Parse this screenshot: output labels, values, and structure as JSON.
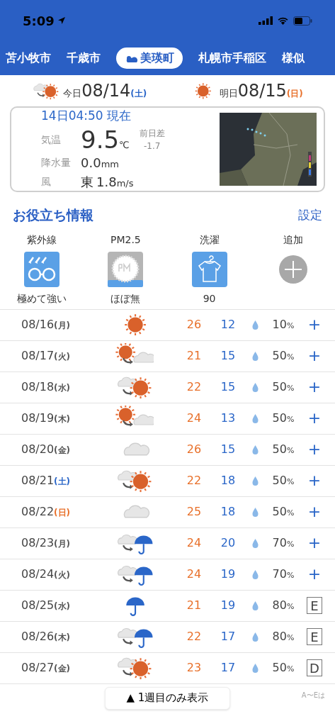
{
  "status_bar": {
    "time": "5:09"
  },
  "tabs": [
    {
      "label": "苫小牧市",
      "selected": false
    },
    {
      "label": "千歳市",
      "selected": false
    },
    {
      "label": "美瑛町",
      "selected": true
    },
    {
      "label": "札幌市手稲区",
      "selected": false
    },
    {
      "label": "様似",
      "selected": false
    }
  ],
  "summary": [
    {
      "weather": {
        "kind": "cloud_to_sun"
      },
      "prefix": "今日",
      "date": "08/14",
      "weekday": "(土)",
      "color": "#2a66c8"
    },
    {
      "weather": {
        "kind": "sun"
      },
      "prefix": "明日",
      "date": "08/15",
      "weekday": "(日)",
      "color": "#e8702a"
    }
  ],
  "current": {
    "heading": "14日04:50 現在",
    "temp_label": "気温",
    "temp": "9.5",
    "temp_unit": "℃",
    "diff_label": "前日差",
    "diff": "-1.7",
    "rain_label": "降水量",
    "rain": "0.0",
    "rain_unit": "mm",
    "wind_label": "風",
    "wind_dir": "東",
    "wind": "1.8",
    "wind_unit": "m/s"
  },
  "info": {
    "title": "お役立ち情報",
    "settings": "設定",
    "items": [
      {
        "kind": "uv",
        "label": "紫外線",
        "value": "極めて強い"
      },
      {
        "kind": "pm25",
        "label": "PM2.5",
        "value": "ほぼ無"
      },
      {
        "kind": "laundry",
        "label": "洗濯",
        "value": "90"
      },
      {
        "kind": "add",
        "label": "追加"
      }
    ]
  },
  "forecast": [
    {
      "date": "08/16",
      "weekday": "(月)",
      "color": "#555555",
      "weather": {
        "kind": "sun"
      },
      "high": "26",
      "low": "12",
      "pop": "10",
      "extra": {
        "kind": "add",
        "text": "+"
      }
    },
    {
      "date": "08/17",
      "weekday": "(火)",
      "color": "#555555",
      "weather": {
        "kind": "sun_to_cloud"
      },
      "high": "21",
      "low": "15",
      "pop": "50",
      "extra": {
        "kind": "add",
        "text": "+"
      }
    },
    {
      "date": "08/18",
      "weekday": "(水)",
      "color": "#555555",
      "weather": {
        "kind": "cloud_to_sun"
      },
      "high": "22",
      "low": "15",
      "pop": "50",
      "extra": {
        "kind": "add",
        "text": "+"
      }
    },
    {
      "date": "08/19",
      "weekday": "(木)",
      "color": "#555555",
      "weather": {
        "kind": "sun_to_cloud"
      },
      "high": "24",
      "low": "13",
      "pop": "50",
      "extra": {
        "kind": "add",
        "text": "+"
      }
    },
    {
      "date": "08/20",
      "weekday": "(金)",
      "color": "#555555",
      "weather": {
        "kind": "cloud"
      },
      "high": "26",
      "low": "15",
      "pop": "50",
      "extra": {
        "kind": "add",
        "text": "+"
      }
    },
    {
      "date": "08/21",
      "weekday": "(土)",
      "color": "#2a66c8",
      "weather": {
        "kind": "cloud_to_sun"
      },
      "high": "22",
      "low": "18",
      "pop": "50",
      "extra": {
        "kind": "add",
        "text": "+"
      }
    },
    {
      "date": "08/22",
      "weekday": "(日)",
      "color": "#e8702a",
      "weather": {
        "kind": "cloud"
      },
      "high": "25",
      "low": "18",
      "pop": "50",
      "extra": {
        "kind": "add",
        "text": "+"
      }
    },
    {
      "date": "08/23",
      "weekday": "(月)",
      "color": "#555555",
      "weather": {
        "kind": "cloud_to_rain"
      },
      "high": "24",
      "low": "20",
      "pop": "70",
      "extra": {
        "kind": "add",
        "text": "+"
      }
    },
    {
      "date": "08/24",
      "weekday": "(火)",
      "color": "#555555",
      "weather": {
        "kind": "cloud_to_rain"
      },
      "high": "24",
      "low": "19",
      "pop": "70",
      "extra": {
        "kind": "add",
        "text": "+"
      }
    },
    {
      "date": "08/25",
      "weekday": "(水)",
      "color": "#555555",
      "weather": {
        "kind": "rain"
      },
      "high": "21",
      "low": "19",
      "pop": "80",
      "extra": {
        "kind": "grade",
        "text": "E"
      }
    },
    {
      "date": "08/26",
      "weekday": "(木)",
      "color": "#555555",
      "weather": {
        "kind": "cloud_to_rain"
      },
      "high": "22",
      "low": "17",
      "pop": "80",
      "extra": {
        "kind": "grade",
        "text": "E"
      }
    },
    {
      "date": "08/27",
      "weekday": "(金)",
      "color": "#555555",
      "weather": {
        "kind": "cloud_to_sun"
      },
      "high": "23",
      "low": "17",
      "pop": "50",
      "extra": {
        "kind": "grade",
        "text": "D"
      }
    }
  ],
  "pop_unit": "%",
  "footer": {
    "button": "▲ 1週目のみ表示",
    "note": "A〜Eは"
  }
}
